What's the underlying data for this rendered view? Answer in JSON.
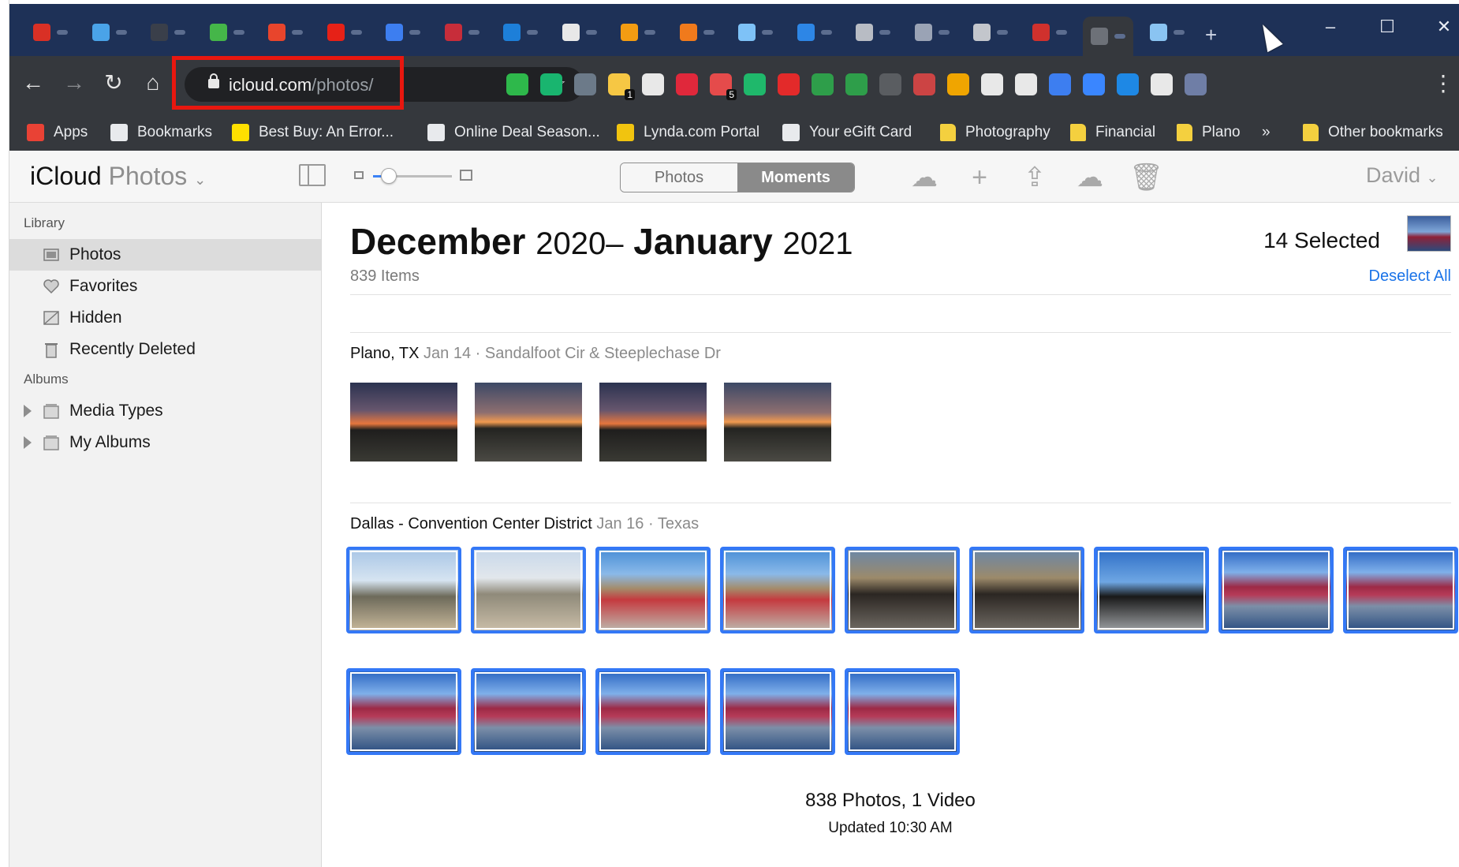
{
  "browser": {
    "tabs": [
      {
        "icon": "gmail-icon",
        "color": "#d93025"
      },
      {
        "icon": "chrome-icon",
        "color": "#4aa3e8"
      },
      {
        "icon": "github-icon",
        "color": "#3a3f4a"
      },
      {
        "icon": "circle-green-icon",
        "color": "#45b649"
      },
      {
        "icon": "office-icon",
        "color": "#e8452c"
      },
      {
        "icon": "youtube-icon",
        "color": "#e62117"
      },
      {
        "icon": "blue-droplet-icon",
        "color": "#3d7ef0"
      },
      {
        "icon": "bookmark-red-icon",
        "color": "#c72d3a"
      },
      {
        "icon": "outlook-icon",
        "color": "#1d7fd9"
      },
      {
        "icon": "camera-icon",
        "color": "#e8e8e8"
      },
      {
        "icon": "orange-circle-icon",
        "color": "#f39c12"
      },
      {
        "icon": "orange-grid-icon",
        "color": "#f07a1c"
      },
      {
        "icon": "chrome-icon",
        "color": "#7ec2f7"
      },
      {
        "icon": "doc-icon",
        "color": "#2d86e6"
      },
      {
        "icon": "gray-icon",
        "color": "#b8bcc4"
      },
      {
        "icon": "screen-icon",
        "color": "#9aa3b5"
      },
      {
        "icon": "gray-icon",
        "color": "#c3c6cc"
      },
      {
        "icon": "red-dash-icon",
        "color": "#d0312d"
      },
      {
        "icon": "active-tab-icon",
        "color": "#6d7178"
      },
      {
        "icon": "chrome-icon",
        "color": "#8ac4f2"
      }
    ],
    "url_host": "icloud.com",
    "url_path": "/photos/",
    "extension_badges": [
      "1",
      "5"
    ],
    "bookmarks": [
      {
        "label": "Apps",
        "icon": "apps-grid-icon",
        "color": "#e94235"
      },
      {
        "label": "Bookmarks",
        "icon": "star-icon",
        "color": "#e8eaed"
      },
      {
        "label": "Best Buy: An Error...",
        "icon": "best-buy-tag-icon",
        "color": "#ffe000"
      },
      {
        "label": "Online Deal Season...",
        "icon": "gd-icon",
        "color": "#e8eaed"
      },
      {
        "label": "Lynda.com Portal",
        "icon": "lynda-icon",
        "color": "#f1c40f"
      },
      {
        "label": "Your eGift Card",
        "icon": "globe-icon",
        "color": "#e8eaed"
      },
      {
        "label": "Photography",
        "icon": "folder-icon",
        "color": "#f4d03f"
      },
      {
        "label": "Financial",
        "icon": "folder-icon",
        "color": "#f4d03f"
      },
      {
        "label": "Plano",
        "icon": "folder-icon",
        "color": "#f4d03f"
      },
      {
        "label": "»",
        "icon": "",
        "color": ""
      },
      {
        "label": "Other bookmarks",
        "icon": "folder-icon",
        "color": "#f4d03f"
      }
    ]
  },
  "app": {
    "brand_main": "iCloud",
    "brand_sub": "Photos",
    "segments": [
      "Photos",
      "Moments"
    ],
    "active_segment": "Moments",
    "user": "David",
    "zoom_level": 0.2
  },
  "sidebar": {
    "library_header": "Library",
    "library_items": [
      "Photos",
      "Favorites",
      "Hidden",
      "Recently Deleted"
    ],
    "albums_header": "Albums",
    "album_items": [
      "Media Types",
      "My Albums"
    ]
  },
  "main": {
    "title_month_start": "December",
    "title_year_start": "2020",
    "title_sep": "–",
    "title_month_end": "January",
    "title_year_end": "2021",
    "items_count": "839 Items",
    "selected_count": "14 Selected",
    "deselect_label": "Deselect All",
    "moments": [
      {
        "place": "Plano, TX",
        "date": "Jan 14",
        "detail": "Sandalfoot Cir & Steeplechase Dr",
        "sep": "·"
      },
      {
        "place": "Dallas - Convention Center District",
        "date": "Jan 16",
        "detail": "Texas",
        "sep": "·"
      }
    ],
    "summary": "838 Photos, 1 Video",
    "updated": "Updated 10:30 AM"
  }
}
